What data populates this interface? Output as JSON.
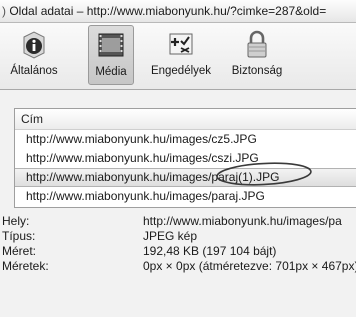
{
  "window": {
    "title": "Oldal adatai – http://www.miabonyunk.hu/?cimke=287&old="
  },
  "toolbar": {
    "items": [
      {
        "label": "Általános",
        "icon": "info-icon",
        "active": false
      },
      {
        "label": "Média",
        "icon": "media-icon",
        "active": true
      },
      {
        "label": "Engedélyek",
        "icon": "permissions-icon",
        "active": false
      },
      {
        "label": "Biztonság",
        "icon": "lock-icon",
        "active": false
      }
    ]
  },
  "media_list": {
    "column_header": "Cím",
    "rows": [
      "http://www.miabonyunk.hu/images/cz5.JPG",
      "http://www.miabonyunk.hu/images/cszi.JPG",
      "http://www.miabonyunk.hu/images/paraj(1).JPG",
      "http://www.miabonyunk.hu/images/paraj.JPG"
    ],
    "selected_index": 2
  },
  "details": [
    {
      "label": "Hely:",
      "value": "http://www.miabonyunk.hu/images/pa"
    },
    {
      "label": "Típus:",
      "value": "JPEG kép"
    },
    {
      "label": "Méret:",
      "value": "192,48 KB (197 104 bájt)"
    },
    {
      "label": "Méretek:",
      "value": "0px × 0px (átméretezve: 701px × 467px)"
    }
  ],
  "colors": {
    "annotation_ellipse": "#3a3a3a",
    "selected_row": "#e3e3e3"
  }
}
